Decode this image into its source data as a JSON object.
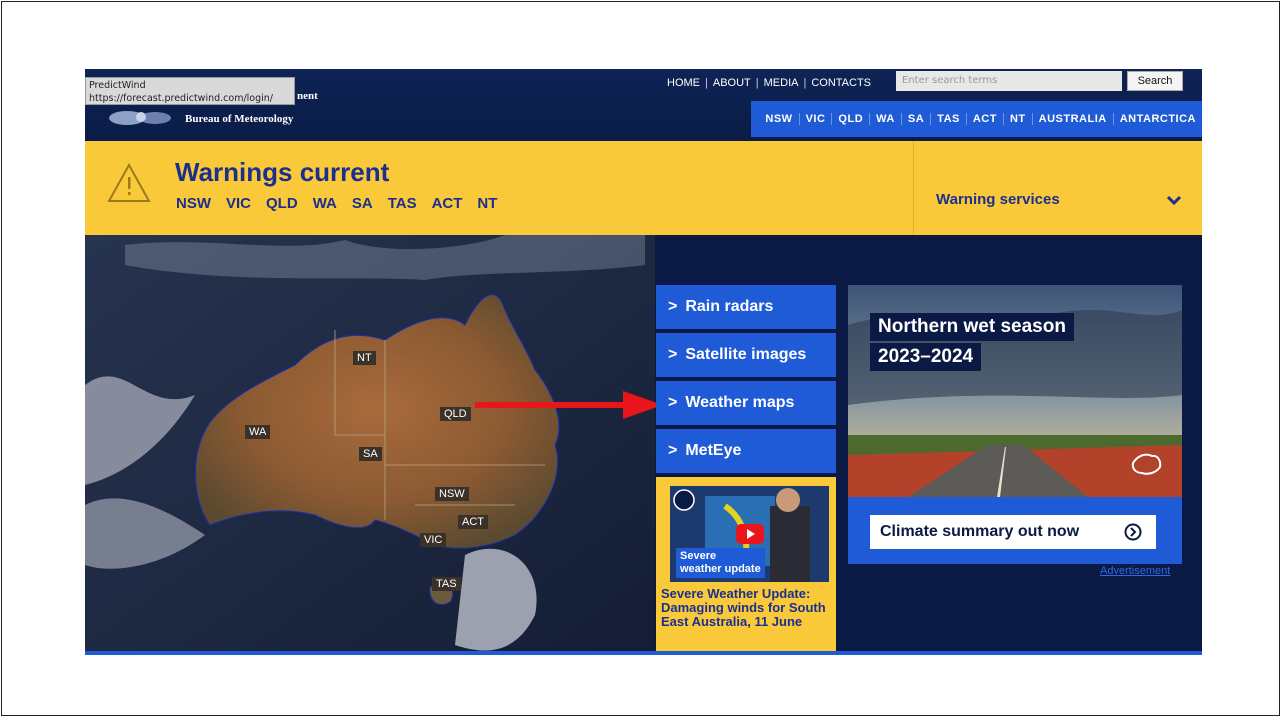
{
  "tooltip": {
    "line1": "PredictWind",
    "line2": "https://forecast.predictwind.com/login/"
  },
  "brand": {
    "line1": "nent",
    "line2": "Bureau of Meteorology"
  },
  "topnav": {
    "items": [
      "HOME",
      "ABOUT",
      "MEDIA",
      "CONTACTS"
    ],
    "separator": "|"
  },
  "search": {
    "placeholder": "Enter search terms",
    "button": "Search"
  },
  "state_nav": [
    "NSW",
    "VIC",
    "QLD",
    "WA",
    "SA",
    "TAS",
    "ACT",
    "NT",
    "AUSTRALIA",
    "ANTARCTICA"
  ],
  "warnings": {
    "title": "Warnings current",
    "states": [
      "NSW",
      "VIC",
      "QLD",
      "WA",
      "SA",
      "TAS",
      "ACT",
      "NT"
    ],
    "services": "Warning services"
  },
  "map": {
    "labels": [
      "NT",
      "QLD",
      "WA",
      "SA",
      "NSW",
      "ACT",
      "VIC",
      "TAS"
    ]
  },
  "links": [
    "Rain radars",
    "Satellite images",
    "Weather maps",
    "MetEye"
  ],
  "video": {
    "tag_line1": "Severe",
    "tag_line2": "weather update",
    "caption": "Severe Weather Update: Damaging winds for South East Australia, 11 June"
  },
  "ad": {
    "heading_line1": "Northern wet season",
    "heading_line2": "2023–2024",
    "button": "Climate summary out now",
    "label": "Advertisement"
  },
  "colors": {
    "navy": "#0b1a45",
    "blue": "#1f5bd6",
    "yellow": "#f9c93a",
    "warning_text": "#1b2f8f",
    "arrow": "#e8151b"
  }
}
